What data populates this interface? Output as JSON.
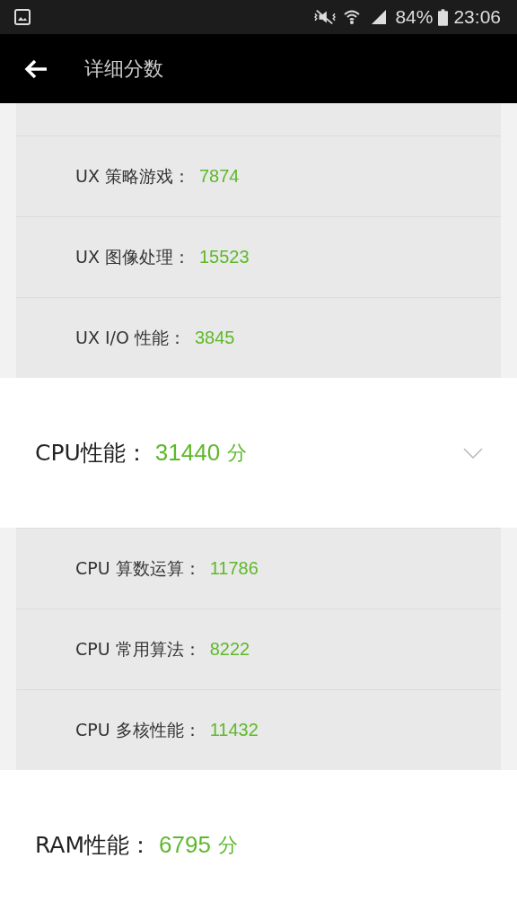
{
  "status_bar": {
    "battery": "84%",
    "time": "23:06"
  },
  "app_bar": {
    "title": "详细分数"
  },
  "ux_items": [
    {
      "label": "UX 策略游戏：",
      "value": "7874"
    },
    {
      "label": "UX 图像处理：",
      "value": "15523"
    },
    {
      "label": "UX I/O 性能：",
      "value": "3845"
    }
  ],
  "sections": [
    {
      "kind": "collapsible",
      "title": "CPU性能：",
      "score": "31440",
      "unit": "分",
      "items": [
        {
          "label": "CPU 算数运算：",
          "value": "11786"
        },
        {
          "label": "CPU 常用算法：",
          "value": "8222"
        },
        {
          "label": "CPU 多核性能：",
          "value": "11432"
        }
      ]
    },
    {
      "kind": "plain",
      "title": "RAM性能：",
      "score": "6795",
      "unit": "分"
    }
  ]
}
